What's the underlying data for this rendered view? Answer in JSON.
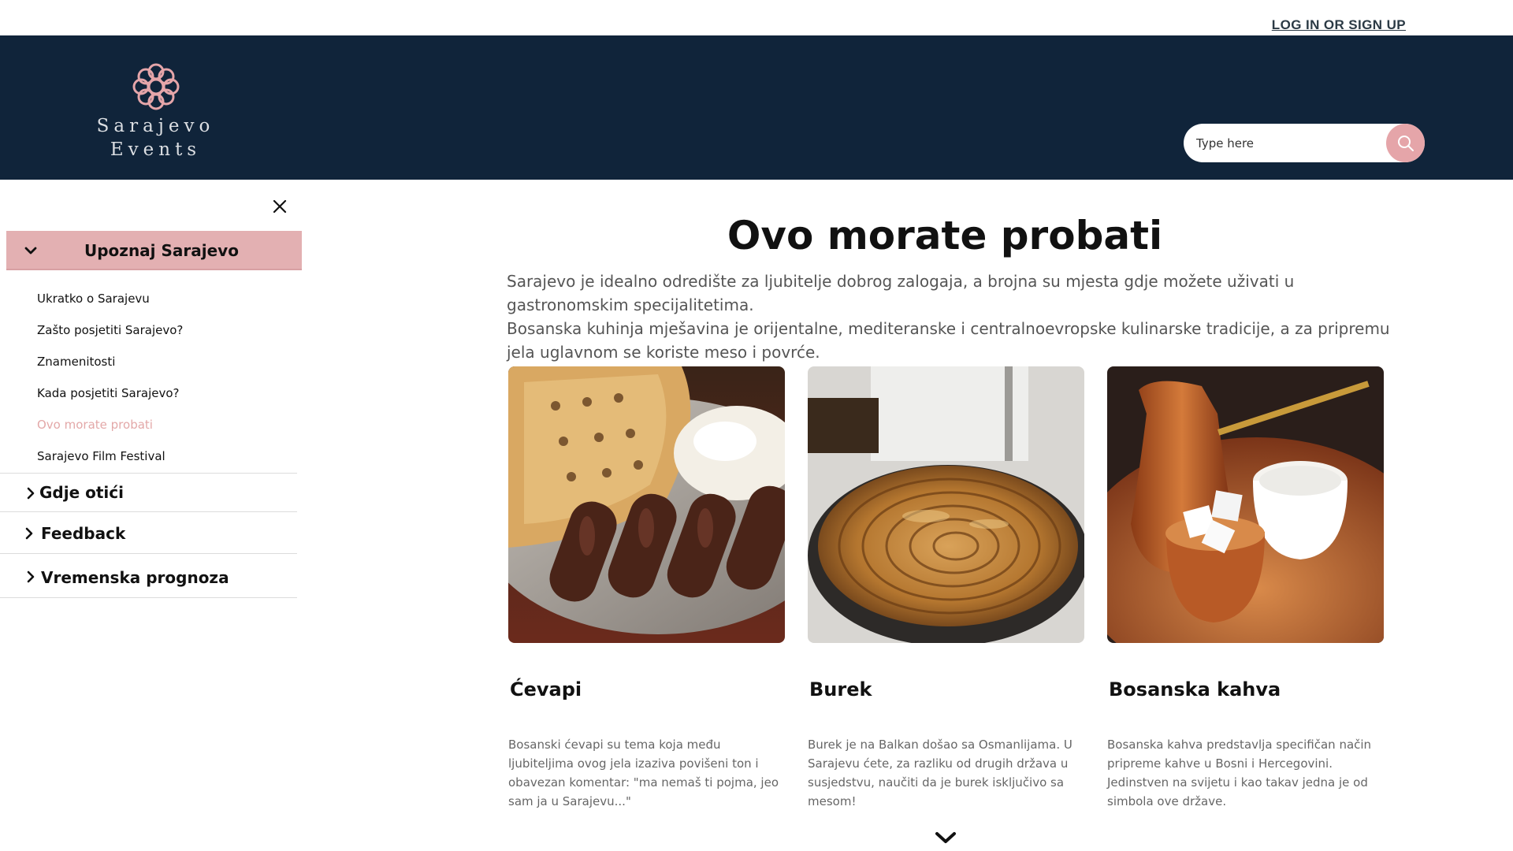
{
  "topbar": {
    "login_label": "LOG IN OR SIGN UP"
  },
  "header": {
    "logo_line1": "Sarajevo",
    "logo_line2": "Events",
    "search_placeholder": "Type here",
    "search_icon": "search-icon",
    "accent_color": "#e5a5a9",
    "background_color": "#10243a"
  },
  "sidebar": {
    "close_icon": "close-icon",
    "active_section": {
      "label": "Upoznaj Sarajevo",
      "background_color": "#e3b0b2",
      "items": [
        {
          "label": "Ukratko o Sarajevu",
          "active": false
        },
        {
          "label": "Zašto posjetiti Sarajevo?",
          "active": false
        },
        {
          "label": "Znamenitosti",
          "active": false
        },
        {
          "label": "Kada posjetiti Sarajevo?",
          "active": false
        },
        {
          "label": "Ovo morate probati",
          "active": true
        },
        {
          "label": "Sarajevo Film Festival",
          "active": false
        }
      ]
    },
    "sections": [
      {
        "label": "Gdje otići"
      },
      {
        "label": "Feedback"
      },
      {
        "label": "Vremenska prognoza"
      }
    ]
  },
  "main": {
    "title": "Ovo morate probati",
    "intro_p1": "Sarajevo je idealno odredište za ljubitelje dobrog zalogaja, a brojna su mjesta gdje možete uživati u gastronomskim specijalitetima.",
    "intro_p2": "Bosanska kuhinja  mješavina je orijentalne, mediteranske i centralnoevropske kulinarske tradicije, a za pripremu jela uglavnom se koriste meso i povrće.",
    "cards": [
      {
        "title": "Ćevapi",
        "text": "Bosanski ćevapi su tema koja među ljubiteljima ovog jela izaziva povišeni ton i obavezan komentar: \"ma nemaš ti pojma, jeo sam ja u Sarajevu...\""
      },
      {
        "title": "Burek",
        "text": "Burek je na Balkan došao sa Osmanlijama. U Sarajevu ćete, za razliku od drugih država u susjedstvu, naučiti da je burek isključivo sa mesom!"
      },
      {
        "title": "Bosanska kahva",
        "text": "Bosanska kahva predstavlja specifičan način pripreme kahve u Bosni i Hercegovini. Jedinstven na svijetu i kao takav jedna je od simbola ove države."
      }
    ],
    "scroll_icon": "chevron-down-icon"
  }
}
